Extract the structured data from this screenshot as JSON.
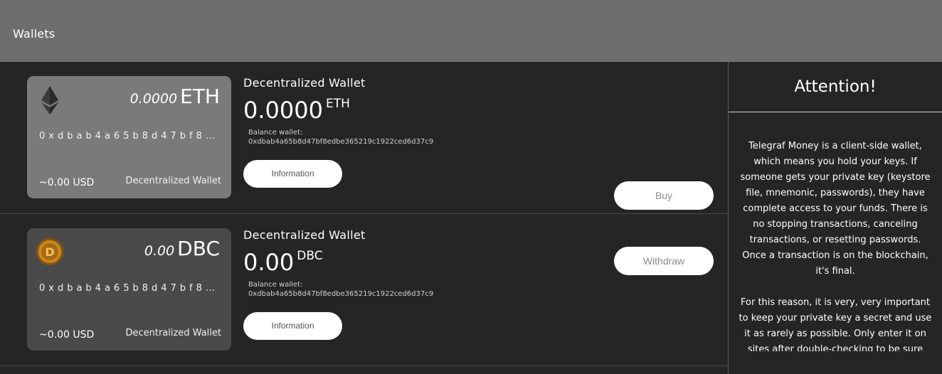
{
  "header": {
    "title": "Wallets"
  },
  "wallets": [
    {
      "card_amount": "0.0000",
      "symbol": "ETH",
      "address": "0xdbab4a65b8d47bf8edbe365219c1922ced6d37c9",
      "usd": "~0.00 USD",
      "wallet_type": "Decentralized Wallet",
      "name": "Decentralized Wallet",
      "balance": "0.0000",
      "balance_label": "Balance wallet:",
      "info_label": "Information",
      "logo_icon": "ethereum-icon"
    },
    {
      "card_amount": "0.00",
      "symbol": "DBC",
      "address": "0xdbab4a65b8d47bf8edbe365219c1922ced6d37c9",
      "usd": "~0.00 USD",
      "wallet_type": "Decentralized Wallet",
      "name": "Decentralized Wallet",
      "balance": "0.00",
      "balance_label": "Balance wallet:",
      "info_label": "Information",
      "logo_icon": "dbc-coin-icon",
      "buy_label": "Buy",
      "withdraw_label": "Withdraw"
    }
  ],
  "sidebar": {
    "title": "Attention!",
    "paragraphs": [
      "Telegraf Money is a client-side wallet, which means you hold your keys. If someone gets your private key (keystore file, mnemonic, passwords), they have complete access to your funds. There is no stopping transactions, canceling transactions, or resetting passwords. Once a transaction is on the blockchain, it's final.",
      "For this reason, it is very, very important to keep your private key a secret and use it as rarely as possible. Only enter it on sites after double-checking to be sure you are on the correct site."
    ]
  },
  "colors": {
    "header_bg": "#6e6e6e",
    "page_bg": "#252525",
    "eth_card_bg": "#7a7a7a",
    "dbc_card_bg": "#4a4a4a",
    "coin_gold": "#c98a1e"
  }
}
